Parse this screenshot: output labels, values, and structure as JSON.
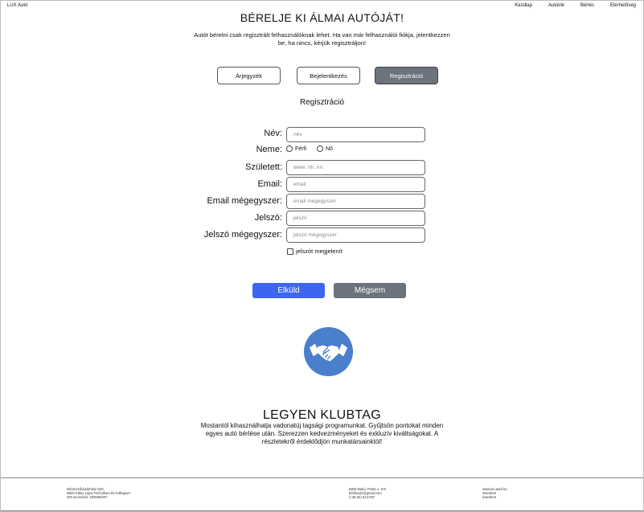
{
  "header": {
    "brand": "LUX Autó",
    "nav": [
      "Kezdlap",
      "Autóink",
      "Bérlés",
      "Elérhetőség"
    ]
  },
  "hero": {
    "title": "BÉRELJE KI ÁLMAI AUTÓJÁT!",
    "text": "Autót bérelni csak regisztrált felhasználóknak lehet. Ha van már felhasználói fiókja, jelentkezzen be, ha nincs, kérjük regisztráljon!"
  },
  "tabs": [
    {
      "label": "Árjegyzék",
      "active": false
    },
    {
      "label": "Bejelentkezés",
      "active": false
    },
    {
      "label": "Regisztráció",
      "active": true
    }
  ],
  "form": {
    "title": "Regisztráció",
    "name_label": "Név:",
    "name_placeholder": "név",
    "gender_label": "Neme:",
    "gender_options": [
      "Férfi",
      "Nő"
    ],
    "birth_label": "Született:",
    "birth_placeholder": "éééé. hh. nn.",
    "email_label": "Email:",
    "email_placeholder": "email",
    "email2_label": "Email mégegyszer:",
    "email2_placeholder": "email mégegyszer",
    "password_label": "Jelszó:",
    "password_placeholder": "jelszó",
    "password2_label": "Jelszó mégegyszer:",
    "password2_placeholder": "jelszó mégegyszer",
    "show_password_label": "jelszót megjelenít",
    "submit_label": "Elküld",
    "cancel_label": "Mégsem"
  },
  "club": {
    "title": "LEGYEN KLUBTAG",
    "text": "Mostantól kihasználhatja vadonatúj tagsági programunkat. Gyűjtsön pontokat minden egyes autó bérlése után. Szerezzen kedvezményeket és exkluzív kiváltságokat. A részletekről érdeklődjön munkatársainktól!"
  },
  "footer": {
    "col1": [
      "Mézmezővásárhelyi SZC",
      "Mikló Kálay Lajos Technikum és Kollégium",
      "OM azonosító: 203058/007"
    ],
    "col2": [
      "6800 Makó, Posta u. 8-9.",
      "bérlőautó@gmail.com",
      "(+36 62) 613-007"
    ],
    "col3": [
      "www.lux-autó.hu",
      "instorkert",
      "instorkert"
    ]
  },
  "colors": {
    "primary": "#3d66f0",
    "secondary": "#6b737c",
    "icon": "#4a7fcc"
  }
}
